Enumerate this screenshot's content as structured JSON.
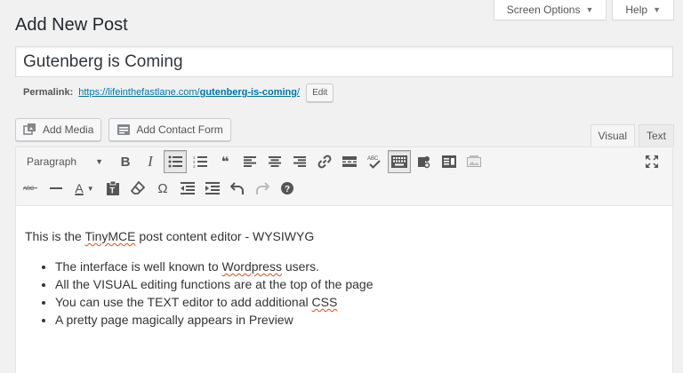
{
  "screen_options": {
    "label": "Screen Options",
    "caret": "▼"
  },
  "help": {
    "label": "Help",
    "caret": "▼"
  },
  "page_title": "Add New Post",
  "post_title": "Gutenberg is Coming",
  "permalink": {
    "label": "Permalink:",
    "base": "https://lifeinthefastlane.com/",
    "slug": "gutenberg-is-coming",
    "trail": "/",
    "edit_label": "Edit"
  },
  "buttons": {
    "add_media": "Add Media",
    "add_contact_form": "Add Contact Form"
  },
  "editor_tabs": {
    "visual": "Visual",
    "text": "Text"
  },
  "toolbar": {
    "format_select": "Paragraph",
    "bold": "B",
    "italic": "I",
    "blockquote": "❝",
    "omega": "Ω",
    "text_color": "A"
  },
  "content": {
    "intro_before": "This is the ",
    "intro_spell": "TinyMCE",
    "intro_after": " post content editor - WYSIWYG",
    "bullets": {
      "b1_before": "The interface is well known to ",
      "b1_spell": "Wordpress",
      "b1_after": " users.",
      "b2": "All the VISUAL editing functions are at the top of the page",
      "b3_before": "You can use the TEXT editor to add additional ",
      "b3_spell": "CSS",
      "b4": "A pretty page magically appears in Preview"
    }
  }
}
